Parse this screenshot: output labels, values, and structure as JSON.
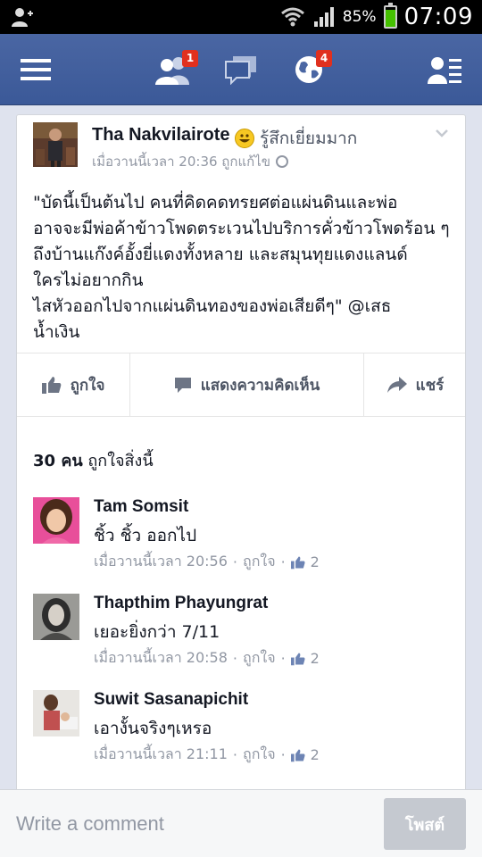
{
  "status_bar": {
    "battery_percent": "85%",
    "battery_level": 0.85,
    "time": "07:09"
  },
  "nav": {
    "friend_requests_badge": "1",
    "notifications_badge": "4"
  },
  "post": {
    "author": "Tha Nakvilairote",
    "feeling": "รู้สึกเยี่ยมมาก",
    "meta": "เมื่อวานนี้เวลา 20:36 ถูกแก้ไข",
    "text": "\"บัดนี้เป็นต้นไป คนที่คิดคดทรยศต่อแผ่นดินและพ่อ\nอาจจะมีพ่อค้าข้าวโพดตระเวนไปบริการคั่วข้าวโพดร้อน ๆ\nถึงบ้านแก๊งค์อั้งยี่แดงทั้งหลาย และสมุนทุยแดงแลนด์\nใครไม่อยากกิน\nไสหัวออกไปจากแผ่นดินทองของพ่อเสียดีๆ\" @เสธ\nน้ำเงิน",
    "actions": {
      "like": "ถูกใจ",
      "comment": "แสดงความคิดเห็น",
      "share": "แชร์"
    },
    "likes_count": "30 คน",
    "likes_suffix": "ถูกใจสิ่งนี้"
  },
  "comments": [
    {
      "name": "Tam Somsit",
      "text": "ชิ้ว ชิ้ว ออกไป",
      "time": "เมื่อวานนี้เวลา 20:56",
      "like_label": "ถูกใจ",
      "likes": "2"
    },
    {
      "name": "Thapthim Phayungrat",
      "text": "เยอะยิ่งกว่า 7/11",
      "time": "เมื่อวานนี้เวลา 20:58",
      "like_label": "ถูกใจ",
      "likes": "2"
    },
    {
      "name": "Suwit Sasanapichit",
      "text": "เอางั้นจริงๆเหรอ",
      "time": "เมื่อวานนี้เวลา 21:11",
      "like_label": "ถูกใจ",
      "likes": "2"
    }
  ],
  "composer": {
    "placeholder": "Write a comment",
    "post_label": "โพสต์"
  },
  "colors": {
    "brand": "#3b5998",
    "badge": "#e0301e",
    "text_muted": "#9197a3"
  }
}
